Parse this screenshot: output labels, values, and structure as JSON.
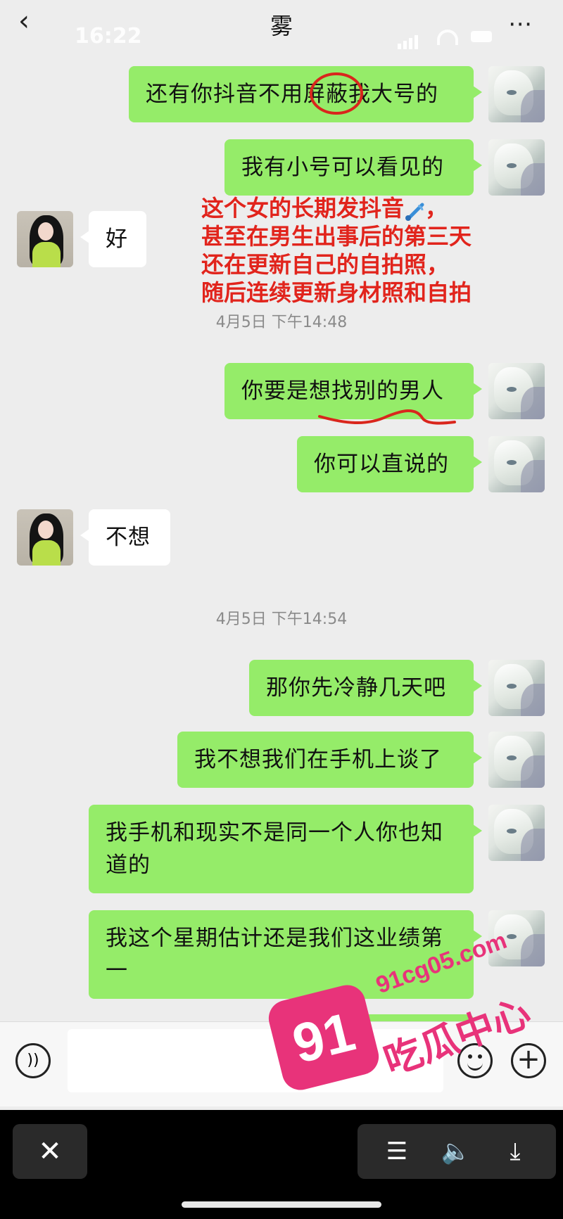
{
  "header": {
    "back_icon": "chevron-left-icon",
    "time": "16:22",
    "title": "雾",
    "more_icon": "more-icon"
  },
  "messages": [
    {
      "side": "right",
      "text": "还有你抖音不用屏蔽我大号的"
    },
    {
      "side": "right",
      "text": "我有小号可以看见的"
    },
    {
      "side": "left",
      "text": "好"
    },
    {
      "side": "right",
      "text": "你要是想找别的男人"
    },
    {
      "side": "right",
      "text": "你可以直说的"
    },
    {
      "side": "left",
      "text": "不想"
    },
    {
      "side": "right",
      "text": "那你先冷静几天吧"
    },
    {
      "side": "right",
      "text": "我不想我们在手机上谈了"
    },
    {
      "side": "right",
      "text": "我手机和现实不是同一个人你也知道的"
    },
    {
      "side": "right",
      "text": "我这个星期估计还是我们这业绩第一"
    }
  ],
  "timestamps": [
    "4月5日 下午14:48",
    "4月5日 下午14:54"
  ],
  "annotation": {
    "lines": [
      "这个女的长期发抖音",
      "甚至在男生出事后的第三天",
      "还在更新自己的自拍照，",
      "随后连续更新身材照和自拍"
    ],
    "line1_suffix": "，",
    "color": "#e1241c"
  },
  "input_bar": {
    "voice_icon": "voice-icon",
    "emoji_icon": "emoji-icon",
    "plus_icon": "plus-icon"
  },
  "player": {
    "close_icon": "close-icon",
    "list_icon": "list-icon",
    "volume_icon": "volume-icon",
    "download_icon": "download-icon"
  },
  "watermark": {
    "badge": "91",
    "url": "91cg05.com",
    "text": "吃瓜中心",
    "color": "#e8337a"
  },
  "colors": {
    "outgoing_bubble": "#95ec69",
    "incoming_bubble": "#ffffff",
    "background": "#ededed"
  }
}
